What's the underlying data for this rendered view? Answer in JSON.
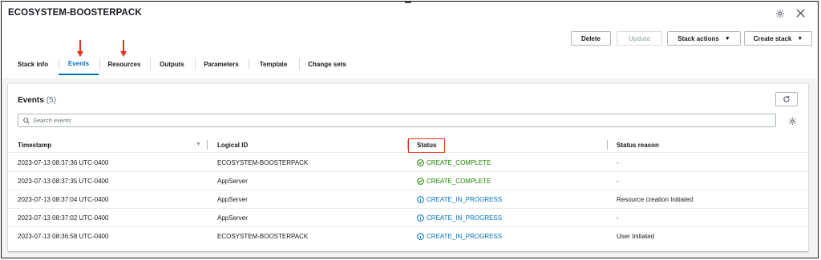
{
  "header": {
    "title": "ECOSYSTEM-BOOSTERPACK"
  },
  "actions": {
    "delete": "Delete",
    "update": "Update",
    "stack_actions": "Stack actions",
    "create_stack": "Create stack"
  },
  "tabs": [
    {
      "label": "Stack info"
    },
    {
      "label": "Events"
    },
    {
      "label": "Resources"
    },
    {
      "label": "Outputs"
    },
    {
      "label": "Parameters"
    },
    {
      "label": "Template"
    },
    {
      "label": "Change sets"
    }
  ],
  "events": {
    "title": "Events",
    "count": "(5)",
    "search_placeholder": "Search events",
    "columns": {
      "timestamp": "Timestamp",
      "logical_id": "Logical ID",
      "status": "Status",
      "status_reason": "Status reason"
    },
    "rows": [
      {
        "timestamp": "2023-07-13 08:37:36 UTC-0400",
        "logical_id": "ECOSYSTEM-BOOSTERPACK",
        "status": "CREATE_COMPLETE",
        "reason": "-"
      },
      {
        "timestamp": "2023-07-13 08:37:35 UTC-0400",
        "logical_id": "AppServer",
        "status": "CREATE_COMPLETE",
        "reason": "-"
      },
      {
        "timestamp": "2023-07-13 08:37:04 UTC-0400",
        "logical_id": "AppServer",
        "status": "CREATE_IN_PROGRESS",
        "reason": "Resource creation Initiated"
      },
      {
        "timestamp": "2023-07-13 08:37:02 UTC-0400",
        "logical_id": "AppServer",
        "status": "CREATE_IN_PROGRESS",
        "reason": "-"
      },
      {
        "timestamp": "2023-07-13 08:36:58 UTC-0400",
        "logical_id": "ECOSYSTEM-BOOSTERPACK",
        "status": "CREATE_IN_PROGRESS",
        "reason": "User Initiated"
      }
    ]
  },
  "colors": {
    "accent": "#0073bb",
    "success": "#1d8102",
    "annotation": "#e8311a"
  },
  "icons": {
    "settings": "gear-icon",
    "close": "close-icon",
    "refresh": "refresh-icon",
    "search": "search-icon",
    "complete": "check-circle-icon",
    "in_progress": "info-circle-icon"
  }
}
